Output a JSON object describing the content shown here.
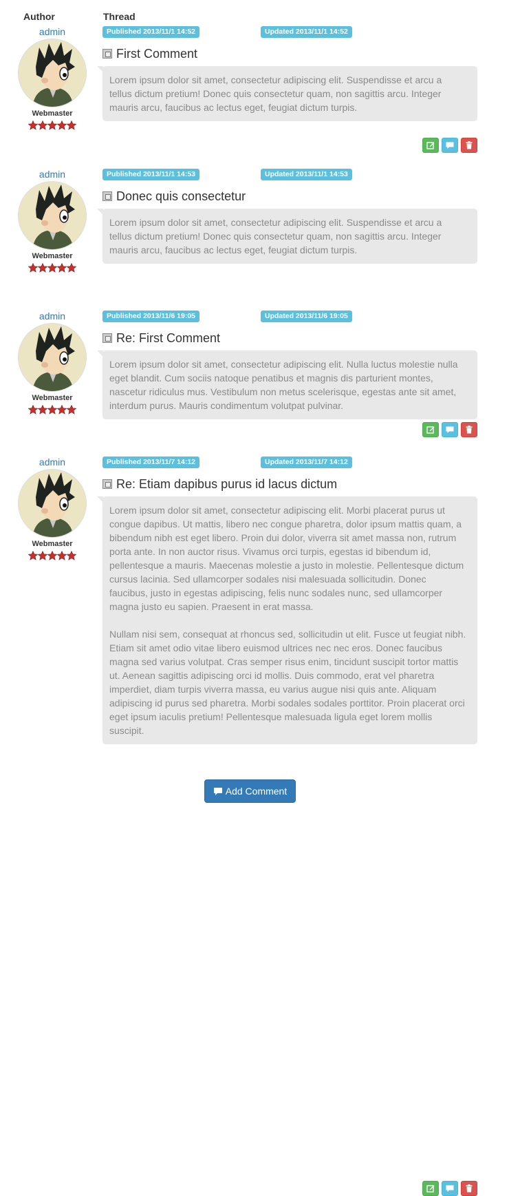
{
  "columns": {
    "author": "Author",
    "thread": "Thread"
  },
  "comments": [
    {
      "author": "admin",
      "role": "Webmaster",
      "stars": 5,
      "published": "Published 2013/11/1 14:52",
      "updated": "Updated 2013/11/1 14:52",
      "title": "First Comment",
      "body": [
        "Lorem ipsum dolor sit amet, consectetur adipiscing elit. Suspendisse et arcu a tellus dictum pretium! Donec quis consectetur quam, non sagittis arcu. Integer mauris arcu, faucibus ac lectus eget, feugiat dictum turpis."
      ]
    },
    {
      "author": "admin",
      "role": "Webmaster",
      "stars": 5,
      "published": "Published 2013/11/1 14:53",
      "updated": "Updated 2013/11/1 14:53",
      "title": "Donec quis consectetur",
      "body": [
        "Lorem ipsum dolor sit amet, consectetur adipiscing elit. Suspendisse et arcu a tellus dictum pretium! Donec quis consectetur quam, non sagittis arcu. Integer mauris arcu, faucibus ac lectus eget, feugiat dictum turpis."
      ]
    },
    {
      "author": "admin",
      "role": "Webmaster",
      "stars": 5,
      "published": "Published 2013/11/6 19:05",
      "updated": "Updated 2013/11/6 19:05",
      "title": "Re: First Comment",
      "body": [
        "Lorem ipsum dolor sit amet, consectetur adipiscing elit. Nulla luctus molestie nulla eget blandit. Cum sociis natoque penatibus et magnis dis parturient montes, nascetur ridiculus mus. Vestibulum non metus scelerisque, egestas ante sit amet, interdum purus. Mauris condimentum volutpat pulvinar."
      ]
    },
    {
      "author": "admin",
      "role": "Webmaster",
      "stars": 5,
      "published": "Published 2013/11/7 14:12",
      "updated": "Updated 2013/11/7 14:12",
      "title": "Re: Etiam dapibus purus id lacus dictum",
      "body": [
        "Lorem ipsum dolor sit amet, consectetur adipiscing elit. Morbi placerat purus ut congue dapibus. Ut mattis, libero nec congue pharetra, dolor ipsum mattis quam, a bibendum nibh est eget libero. Proin dui dolor, viverra sit amet massa non, rutrum porta ante. In non auctor risus. Vivamus orci turpis, egestas id bibendum id, pellentesque a mauris. Maecenas molestie a justo in molestie. Pellentesque dictum cursus lacinia. Sed ullamcorper sodales nisi malesuada sollicitudin. Donec faucibus, justo in egestas adipiscing, felis nunc sodales nunc, sed ullamcorper magna justo eu sapien. Praesent in erat massa.",
        "Nullam nisi sem, consequat at rhoncus sed, sollicitudin ut elit. Fusce ut feugiat nibh. Etiam sit amet odio vitae libero euismod ultrices nec nec eros. Donec faucibus magna sed varius volutpat. Cras semper risus enim, tincidunt suscipit tortor mattis ut. Aenean sagittis adipiscing orci id mollis. Duis commodo, erat vel pharetra imperdiet, diam turpis viverra massa, eu varius augue nisi quis ante. Aliquam adipiscing id purus sed pharetra. Morbi sodales sodales porttitor. Proin placerat orci eget ipsum iaculis pretium! Pellentesque malesuada ligula eget lorem mollis suscipit."
      ]
    }
  ],
  "icons": {
    "edit": "edit-icon",
    "reply": "comment-icon",
    "delete": "trash-icon",
    "title": "document-icon",
    "star": "star-icon"
  },
  "colors": {
    "link": "#337ab7",
    "label": "#5bc0de",
    "success": "#5cb85c",
    "danger": "#d9534f",
    "star": "#c9302c",
    "bubble": "#e8e8e8"
  },
  "add_button": {
    "label": "Add Comment"
  }
}
